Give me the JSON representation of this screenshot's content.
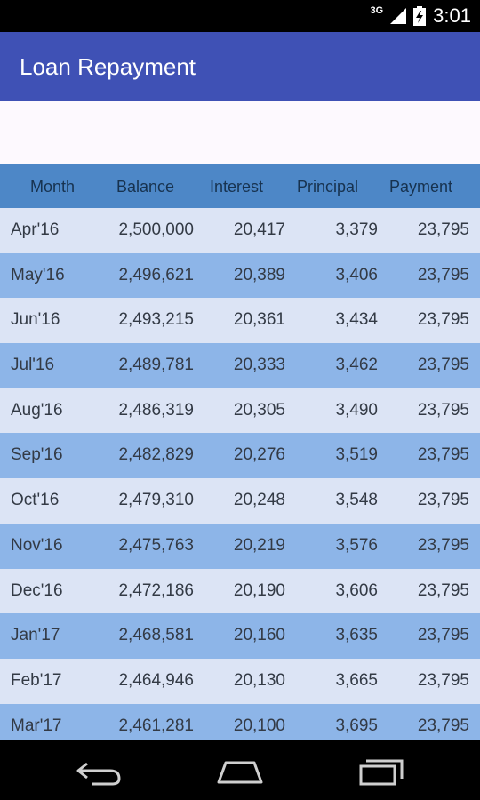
{
  "status_bar": {
    "network": "3G",
    "time": "3:01"
  },
  "app_bar": {
    "title": "Loan Repayment"
  },
  "table": {
    "headers": [
      "Month",
      "Balance",
      "Interest",
      "Principal",
      "Payment"
    ],
    "rows": [
      [
        "Apr'16",
        "2,500,000",
        "20,417",
        "3,379",
        "23,795"
      ],
      [
        "May'16",
        "2,496,621",
        "20,389",
        "3,406",
        "23,795"
      ],
      [
        "Jun'16",
        "2,493,215",
        "20,361",
        "3,434",
        "23,795"
      ],
      [
        "Jul'16",
        "2,489,781",
        "20,333",
        "3,462",
        "23,795"
      ],
      [
        "Aug'16",
        "2,486,319",
        "20,305",
        "3,490",
        "23,795"
      ],
      [
        "Sep'16",
        "2,482,829",
        "20,276",
        "3,519",
        "23,795"
      ],
      [
        "Oct'16",
        "2,479,310",
        "20,248",
        "3,548",
        "23,795"
      ],
      [
        "Nov'16",
        "2,475,763",
        "20,219",
        "3,576",
        "23,795"
      ],
      [
        "Dec'16",
        "2,472,186",
        "20,190",
        "3,606",
        "23,795"
      ],
      [
        "Jan'17",
        "2,468,581",
        "20,160",
        "3,635",
        "23,795"
      ],
      [
        "Feb'17",
        "2,464,946",
        "20,130",
        "3,665",
        "23,795"
      ],
      [
        "Mar'17",
        "2,461,281",
        "20,100",
        "3,695",
        "23,795"
      ]
    ]
  },
  "colors": {
    "app_bar": "#3f51b5",
    "header_bg": "#4d87c7",
    "row_light": "#dce4f5",
    "row_dark": "#8db5e8"
  },
  "nav_icons": [
    "back-icon",
    "home-icon",
    "recents-icon"
  ]
}
